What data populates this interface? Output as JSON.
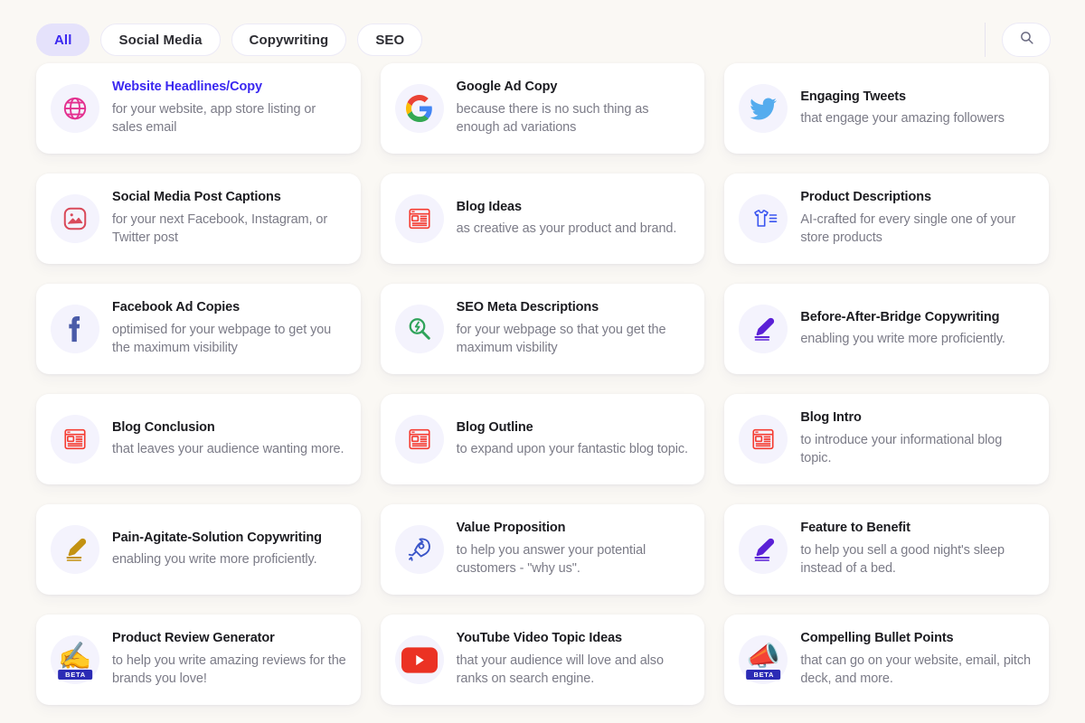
{
  "filters": {
    "chips": [
      {
        "label": "All",
        "active": true
      },
      {
        "label": "Social Media",
        "active": false
      },
      {
        "label": "Copywriting",
        "active": false
      },
      {
        "label": "SEO",
        "active": false
      }
    ],
    "search_icon": "search-icon"
  },
  "colors": {
    "page_background": "#faf8f4",
    "card_background": "#ffffff",
    "accent": "#3a27f0",
    "active_chip_background": "#e5e2fb",
    "icon_disc": "#f4f3fd",
    "title": "#1b1b20",
    "description": "#7b7b87",
    "beta_badge": "#2b2bb5"
  },
  "cards": [
    {
      "title": "Website Headlines/Copy",
      "desc": "for your website, app store listing or sales email",
      "icon": "globe-icon",
      "highlight": true
    },
    {
      "title": "Google Ad Copy",
      "desc": "because there is no such thing as enough ad variations",
      "icon": "google-g-icon",
      "highlight": false
    },
    {
      "title": "Engaging Tweets",
      "desc": "that engage your amazing followers",
      "icon": "twitter-bird-icon",
      "highlight": false
    },
    {
      "title": "Social Media Post Captions",
      "desc": "for your next Facebook, Instagram, or Twitter post",
      "icon": "image-icon",
      "highlight": false
    },
    {
      "title": "Blog Ideas",
      "desc": "as creative as your product and brand.",
      "icon": "newspaper-icon",
      "highlight": false
    },
    {
      "title": "Product Descriptions",
      "desc": "AI-crafted for every single one of your store products",
      "icon": "tshirt-list-icon",
      "highlight": false
    },
    {
      "title": "Facebook Ad Copies",
      "desc": "optimised for your webpage to get you the maximum visibility",
      "icon": "facebook-f-icon",
      "highlight": false
    },
    {
      "title": "SEO Meta Descriptions",
      "desc": "for your webpage so that you get the maximum visbility",
      "icon": "seo-magnifier-icon",
      "highlight": false
    },
    {
      "title": "Before-After-Bridge Copywriting",
      "desc": "enabling you write more proficiently.",
      "icon": "pen-purple-icon",
      "highlight": false
    },
    {
      "title": "Blog Conclusion",
      "desc": "that leaves your audience wanting more.",
      "icon": "newspaper-icon",
      "highlight": false
    },
    {
      "title": "Blog Outline",
      "desc": "to expand upon your fantastic blog topic.",
      "icon": "newspaper-icon",
      "highlight": false
    },
    {
      "title": "Blog Intro",
      "desc": "to introduce your informational blog topic.",
      "icon": "newspaper-icon",
      "highlight": false
    },
    {
      "title": "Pain-Agitate-Solution Copywriting",
      "desc": "enabling you write more proficiently.",
      "icon": "pen-gold-icon",
      "highlight": false
    },
    {
      "title": "Value Proposition",
      "desc": "to help you answer your potential customers - \"why us\".",
      "icon": "rocket-icon",
      "highlight": false
    },
    {
      "title": "Feature to Benefit",
      "desc": "to help you sell a good night's sleep instead of a bed.",
      "icon": "pen-purple-icon",
      "highlight": false
    },
    {
      "title": "Product Review Generator",
      "desc": "to help you write amazing reviews for the brands you love!",
      "icon": "writing-hand-emoji-icon",
      "badge": "BETA",
      "highlight": false
    },
    {
      "title": "YouTube Video Topic Ideas",
      "desc": "that your audience will love and also ranks on search engine.",
      "icon": "youtube-icon",
      "highlight": false
    },
    {
      "title": "Compelling Bullet Points",
      "desc": "that can go on your website, email, pitch deck, and more.",
      "icon": "megaphone-emoji-icon",
      "badge": "BETA",
      "highlight": false
    }
  ]
}
